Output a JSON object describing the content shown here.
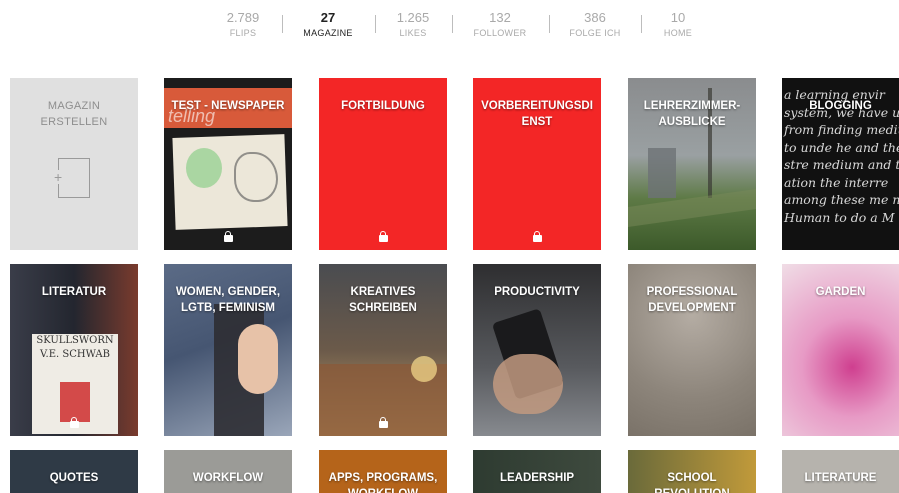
{
  "stats": [
    {
      "value": "2.789",
      "label": "FLIPS",
      "active": false
    },
    {
      "value": "27",
      "label": "MAGAZINE",
      "active": true
    },
    {
      "value": "1.265",
      "label": "LIKES",
      "active": false
    },
    {
      "value": "132",
      "label": "FOLLOWER",
      "active": false
    },
    {
      "value": "386",
      "label": "FOLGE ICH",
      "active": false
    },
    {
      "value": "10",
      "label": "HOME",
      "active": false
    }
  ],
  "create_tile": {
    "label": "MAGAZIN ERSTELLEN",
    "icon": "add-magazine-icon"
  },
  "magazines_row1": [
    {
      "title": "TEST - NEWSPAPER",
      "private": true,
      "cover_text": "telling"
    },
    {
      "title": "FORTBILDUNG",
      "private": true,
      "color": "#f32626"
    },
    {
      "title": "VORBEREITUNGSDIENST",
      "private": true,
      "color": "#f32626"
    },
    {
      "title": "LEHRERZIMMER-AUSBLICKE",
      "private": false
    },
    {
      "title": "BLOGGING",
      "private": false,
      "cover_text": "a learning envir system, we have us from finding medium to unde he and the stre medium and tak ation the interre among these me nd a Human to do a M"
    }
  ],
  "magazines_row2": [
    {
      "title": "LITERATUR",
      "private": true,
      "cover_text": "SKULLSWORN V.E. SCHWAB"
    },
    {
      "title": "WOMEN, GENDER, LGTB, FEMINISM",
      "private": false
    },
    {
      "title": "KREATIVES SCHREIBEN",
      "private": true
    },
    {
      "title": "PRODUCTIVITY",
      "private": false
    },
    {
      "title": "PROFESSIONAL DEVELOPMENT",
      "private": false
    },
    {
      "title": "GARDEN",
      "private": false
    }
  ],
  "magazines_row3": [
    {
      "title": "QUOTES"
    },
    {
      "title": "WORKFLOW"
    },
    {
      "title": "APPS, PROGRAMS, WORKFLOW"
    },
    {
      "title": "LEADERSHIP"
    },
    {
      "title": "SCHOOL REVOLUTION"
    },
    {
      "title": "LITERATURE"
    }
  ]
}
